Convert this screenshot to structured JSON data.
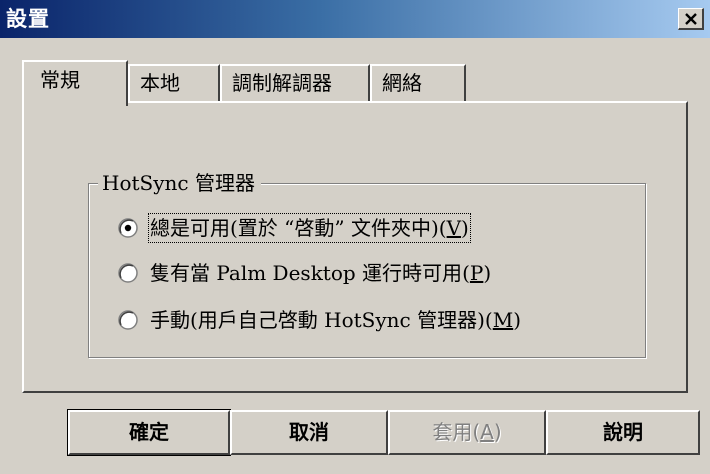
{
  "window": {
    "title": "設置",
    "close_icon": "close-icon"
  },
  "tabs": [
    {
      "label": "常規",
      "active": true
    },
    {
      "label": "本地",
      "active": false
    },
    {
      "label": "調制解調器",
      "active": false
    },
    {
      "label": "網絡",
      "active": false
    }
  ],
  "group": {
    "legend": "HotSync 管理器",
    "options": [
      {
        "label": "總是可用(置於 “啓動” 文件夾中)",
        "mnemonic": "V",
        "selected": true
      },
      {
        "label": "隻有當 Palm Desktop 運行時可用",
        "mnemonic": "P",
        "selected": false
      },
      {
        "label": "手動(用戶自己啓動 HotSync 管理器)",
        "mnemonic": "M",
        "selected": false
      }
    ]
  },
  "buttons": {
    "ok": "確定",
    "cancel": "取消",
    "apply": "套用",
    "apply_mnemonic": "A",
    "help": "說明"
  },
  "colors": {
    "titlebar_start": "#0a246a",
    "titlebar_end": "#a6caf0",
    "face": "#d4d0c8"
  }
}
